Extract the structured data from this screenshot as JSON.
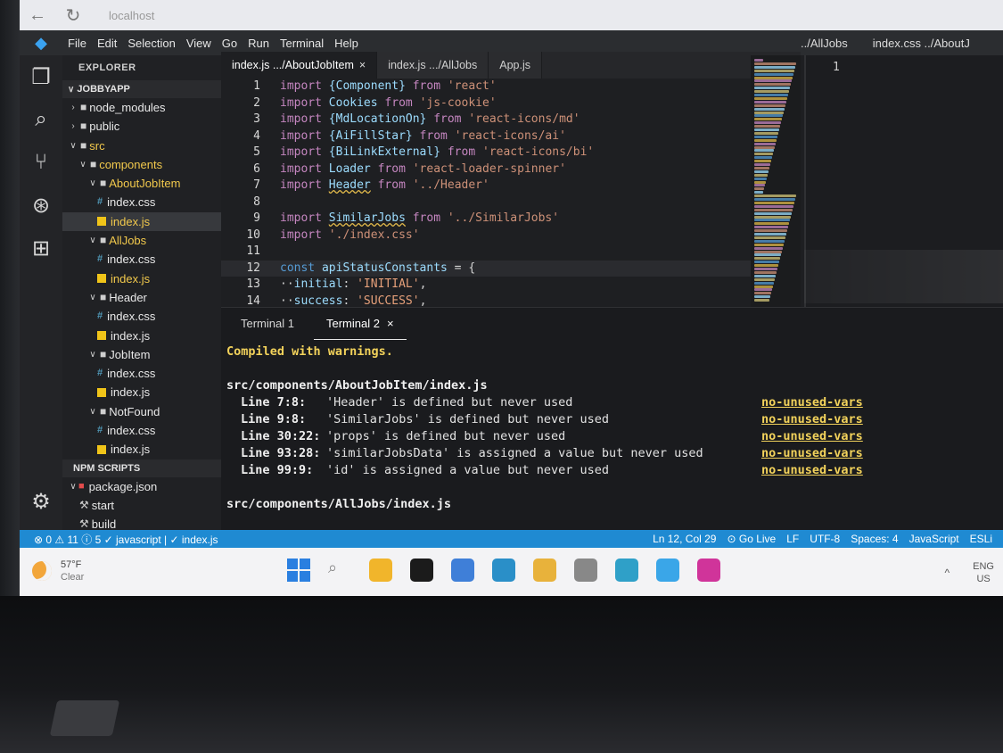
{
  "browser": {
    "back_icon": "back-arrow-icon",
    "reload_icon": "reload-icon",
    "url": "localhost"
  },
  "menu": {
    "items": [
      "File",
      "Edit",
      "Selection",
      "View",
      "Go",
      "Run",
      "Terminal",
      "Help"
    ],
    "right_tabs": [
      "../AllJobs",
      "index.css ../AboutJ"
    ]
  },
  "activity_icons": [
    "files-icon",
    "search-icon",
    "source-control-icon",
    "run-debug-icon",
    "extensions-icon",
    "gear-icon"
  ],
  "explorer": {
    "title": "EXPLORER",
    "project": "JOBBYAPP",
    "tree": [
      {
        "label": "node_modules",
        "kind": "folder",
        "depth": 0,
        "open": false
      },
      {
        "label": "public",
        "kind": "folder",
        "depth": 0,
        "open": false
      },
      {
        "label": "src",
        "kind": "folder",
        "depth": 0,
        "open": true,
        "modified": true
      },
      {
        "label": "components",
        "kind": "folder",
        "depth": 1,
        "open": true,
        "modified": true
      },
      {
        "label": "AboutJobItem",
        "kind": "folder",
        "depth": 2,
        "open": true,
        "modified": true
      },
      {
        "label": "index.css",
        "kind": "css",
        "depth": 3
      },
      {
        "label": "index.js",
        "kind": "js",
        "depth": 3,
        "modified": true,
        "active": true
      },
      {
        "label": "AllJobs",
        "kind": "folder",
        "depth": 2,
        "open": true,
        "modified": true
      },
      {
        "label": "index.css",
        "kind": "css",
        "depth": 3
      },
      {
        "label": "index.js",
        "kind": "js",
        "depth": 3,
        "modified": true
      },
      {
        "label": "Header",
        "kind": "folder",
        "depth": 2,
        "open": true
      },
      {
        "label": "index.css",
        "kind": "css",
        "depth": 3
      },
      {
        "label": "index.js",
        "kind": "js",
        "depth": 3
      },
      {
        "label": "JobItem",
        "kind": "folder",
        "depth": 2,
        "open": true
      },
      {
        "label": "index.css",
        "kind": "css",
        "depth": 3
      },
      {
        "label": "index.js",
        "kind": "js",
        "depth": 3
      },
      {
        "label": "NotFound",
        "kind": "folder",
        "depth": 2,
        "open": true
      },
      {
        "label": "index.css",
        "kind": "css",
        "depth": 3
      },
      {
        "label": "index.js",
        "kind": "js",
        "depth": 3
      }
    ],
    "npm_title": "NPM SCRIPTS",
    "npm_tree": [
      {
        "label": "package.json",
        "kind": "pkg",
        "depth": 0
      },
      {
        "label": "start",
        "kind": "script",
        "depth": 1
      },
      {
        "label": "build",
        "kind": "script",
        "depth": 1
      }
    ]
  },
  "tabs": [
    {
      "label": "index.js .../AboutJobItem",
      "active": true,
      "close": "×"
    },
    {
      "label": "index.js .../AllJobs",
      "active": false
    },
    {
      "label": "App.js",
      "active": false
    }
  ],
  "code": [
    [
      {
        "t": "import ",
        "c": "kw"
      },
      {
        "t": "{Component}",
        "c": "fn"
      },
      {
        "t": " from ",
        "c": "kw"
      },
      {
        "t": "'react'",
        "c": "str"
      }
    ],
    [
      {
        "t": "import ",
        "c": "kw"
      },
      {
        "t": "Cookies",
        "c": "fn"
      },
      {
        "t": " from ",
        "c": "kw"
      },
      {
        "t": "'js-cookie'",
        "c": "str"
      }
    ],
    [
      {
        "t": "import ",
        "c": "kw"
      },
      {
        "t": "{MdLocationOn}",
        "c": "fn"
      },
      {
        "t": " from ",
        "c": "kw"
      },
      {
        "t": "'react-icons/md'",
        "c": "str"
      }
    ],
    [
      {
        "t": "import ",
        "c": "kw"
      },
      {
        "t": "{AiFillStar}",
        "c": "fn"
      },
      {
        "t": " from ",
        "c": "kw"
      },
      {
        "t": "'react-icons/ai'",
        "c": "str"
      }
    ],
    [
      {
        "t": "import ",
        "c": "kw"
      },
      {
        "t": "{BiLinkExternal}",
        "c": "fn"
      },
      {
        "t": " from ",
        "c": "kw"
      },
      {
        "t": "'react-icons/bi'",
        "c": "str"
      }
    ],
    [
      {
        "t": "import ",
        "c": "kw"
      },
      {
        "t": "Loader",
        "c": "fn"
      },
      {
        "t": " from ",
        "c": "kw"
      },
      {
        "t": "'react-loader-spinner'",
        "c": "str"
      }
    ],
    [
      {
        "t": "import ",
        "c": "kw"
      },
      {
        "t": "Header",
        "c": "fn squig"
      },
      {
        "t": " from ",
        "c": "kw"
      },
      {
        "t": "'../Header'",
        "c": "str"
      }
    ],
    [],
    [
      {
        "t": "import ",
        "c": "kw"
      },
      {
        "t": "SimilarJobs",
        "c": "fn squig"
      },
      {
        "t": " from ",
        "c": "kw"
      },
      {
        "t": "'../SimilarJobs'",
        "c": "str"
      }
    ],
    [
      {
        "t": "import ",
        "c": "kw"
      },
      {
        "t": "'./index.css'",
        "c": "str"
      }
    ],
    [],
    [
      {
        "t": "const ",
        "c": "kw2"
      },
      {
        "t": "apiStatusConstants",
        "c": "fn"
      },
      {
        "t": " = {",
        "c": "plain"
      }
    ],
    [
      {
        "t": "··",
        "c": "plain"
      },
      {
        "t": "initial",
        "c": "fn"
      },
      {
        "t": ": ",
        "c": "plain"
      },
      {
        "t": "'INITIAL'",
        "c": "str2"
      },
      {
        "t": ",",
        "c": "plain"
      }
    ],
    [
      {
        "t": "··",
        "c": "plain"
      },
      {
        "t": "success",
        "c": "fn"
      },
      {
        "t": ": ",
        "c": "plain"
      },
      {
        "t": "'SUCCESS'",
        "c": "str2"
      },
      {
        "t": ",",
        "c": "plain"
      }
    ]
  ],
  "right_pane_line": "1",
  "terminal": {
    "tabs": [
      {
        "label": "Terminal 1",
        "active": false
      },
      {
        "label": "Terminal 2",
        "active": true,
        "close": "×"
      }
    ],
    "header": "Compiled with warnings.",
    "file1": "src/components/AboutJobItem/index.js",
    "warnings": [
      {
        "line": "Line 7:8:",
        "msg": "'Header' is defined but never used",
        "rule": "no-unused-vars"
      },
      {
        "line": "Line 9:8:",
        "msg": "'SimilarJobs' is defined but never used",
        "rule": "no-unused-vars"
      },
      {
        "line": "Line 30:22:",
        "msg": "'props' is defined but never used",
        "rule": "no-unused-vars"
      },
      {
        "line": "Line 93:28:",
        "msg": "'similarJobsData' is assigned a value but never used",
        "rule": "no-unused-vars"
      },
      {
        "line": "Line 99:9:",
        "msg": "'id' is assigned a value but never used",
        "rule": "no-unused-vars"
      }
    ],
    "file2": "src/components/AllJobs/index.js"
  },
  "status": {
    "left": "⊗ 0 ⚠ 11 ⓘ 5  ✓ javascript | ✓ index.js",
    "right": [
      "Ln 12, Col 29",
      "⊙ Go Live",
      "LF",
      "UTF-8",
      "Spaces: 4",
      "JavaScript",
      "ESLi"
    ]
  },
  "taskbar": {
    "temp": "57°F",
    "cond": "Clear",
    "lang": "ENG",
    "region": "US",
    "caret": "^",
    "icon_colors": [
      "#2a7fe0",
      "#c9c9cc",
      "#f1b52b",
      "#1b1b1b",
      "#3f7fd8",
      "#2a8fc8",
      "#e8b23b",
      "#888888",
      "#2fa0c8",
      "#3aa6e8",
      "#d0349a"
    ]
  },
  "colors": {
    "accent": "#1f8ad2",
    "warning": "#f2d25b"
  }
}
